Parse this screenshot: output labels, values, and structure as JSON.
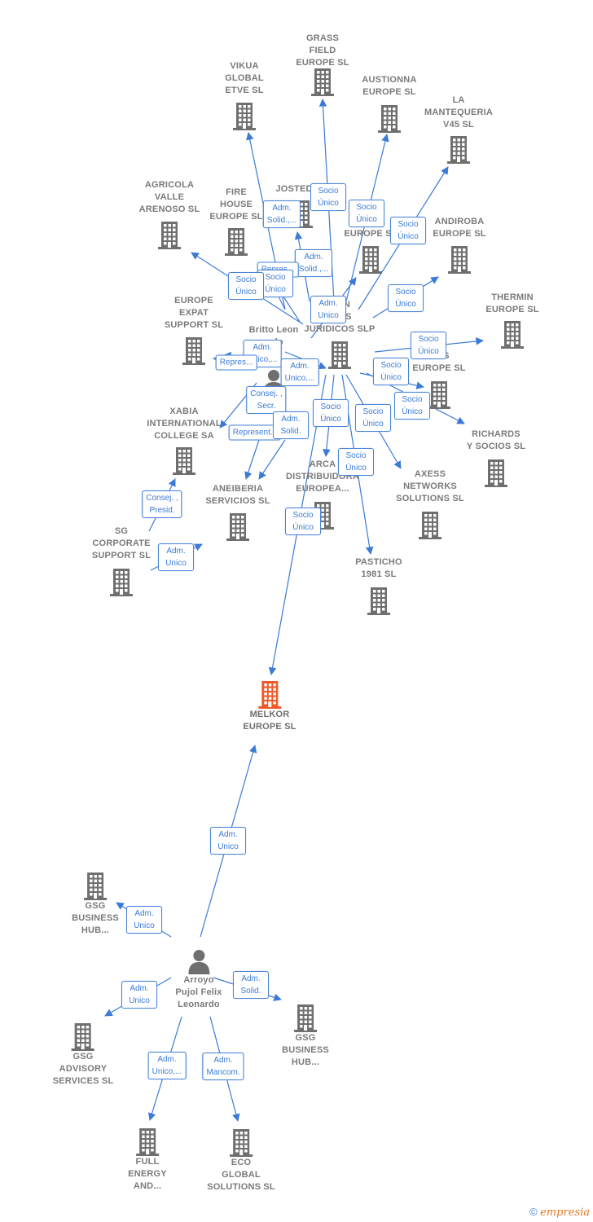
{
  "colors": {
    "edge": "#3b7ad6",
    "node": "#6f6f6f",
    "main_node": "#f05a28"
  },
  "nodes": [
    {
      "id": "melkor",
      "type": "company",
      "main": true,
      "label": "MELKOR\nEUROPE SL"
    },
    {
      "id": "grass",
      "type": "company",
      "label": "GRASS\nFIELD\nEUROPE SL"
    },
    {
      "id": "vikua",
      "type": "company",
      "label": "VIKUA\nGLOBAL\nETVE SL"
    },
    {
      "id": "austionna",
      "type": "company",
      "label": "AUSTIONNA\nEUROPE SL"
    },
    {
      "id": "mantequeria",
      "type": "company",
      "label": "LA\nMANTEQUERIA\nV45 SL"
    },
    {
      "id": "agricola",
      "type": "company",
      "label": "AGRICOLA\nVALLE\nARENOSO SL"
    },
    {
      "id": "fire",
      "type": "company",
      "label": "FIRE\nHOUSE\nEUROPE SL"
    },
    {
      "id": "jostedal",
      "type": "company",
      "label": "JOSTEDA..."
    },
    {
      "id": "aeurope",
      "type": "company",
      "label": "EUROPE SL"
    },
    {
      "id": "andiroba",
      "type": "company",
      "label": "ANDIROBA\nEUROPE SL"
    },
    {
      "id": "thermin",
      "type": "company",
      "label": "THERMIN\nEUROPE SL"
    },
    {
      "id": "expat",
      "type": "company",
      "label": "EUROPE\nEXPAT\nSUPPORT SL"
    },
    {
      "id": "britto",
      "type": "person",
      "label": "Britto Leon\n...do"
    },
    {
      "id": "juridicos",
      "type": "company",
      "label": "...AN\n...IOS\nJURIDICOS SLP"
    },
    {
      "id": "aseurope",
      "type": "company",
      "label": "...AS\nEUROPE SL"
    },
    {
      "id": "richards",
      "type": "company",
      "label": "RICHARDS\nY SOCIOS SL"
    },
    {
      "id": "xabia",
      "type": "company",
      "label": "XABIA\nINTERNATIONAL\nCOLLEGE SA"
    },
    {
      "id": "aneiberia",
      "type": "company",
      "label": "ANEIBERIA\nSERVICIOS SL"
    },
    {
      "id": "arca",
      "type": "company",
      "label": "ARCA\nDISTRIBUIDORA\nEUROPEA..."
    },
    {
      "id": "axess",
      "type": "company",
      "label": "AXESS\nNETWORKS\nSOLUTIONS SL"
    },
    {
      "id": "pasticho",
      "type": "company",
      "label": "PASTICHO\n1981 SL"
    },
    {
      "id": "sg",
      "type": "company",
      "label": "SG\nCORPORATE\nSUPPORT SL"
    },
    {
      "id": "gsg1",
      "type": "company",
      "label": "GSG\nBUSINESS\nHUB..."
    },
    {
      "id": "arroyo",
      "type": "person",
      "label": "Arroyo\nPujol Felix\nLeonardo"
    },
    {
      "id": "gsg2",
      "type": "company",
      "label": "GSG\nBUSINESS\nHUB..."
    },
    {
      "id": "advisory",
      "type": "company",
      "label": "GSG\nADVISORY\nSERVICES SL"
    },
    {
      "id": "full",
      "type": "company",
      "label": "FULL\nENERGY\nAND..."
    },
    {
      "id": "eco",
      "type": "company",
      "label": "ECO\nGLOBAL\nSOLUTIONS SL"
    }
  ],
  "edges": [
    {
      "from": "juridicos",
      "to": "grass",
      "label": "Socio\nÚnico"
    },
    {
      "from": "britto",
      "to": "vikua",
      "label": "Adm.\nSolid.,..."
    },
    {
      "from": "juridicos",
      "to": "austionna",
      "label": "Socio\nÚnico"
    },
    {
      "from": "juridicos",
      "to": "mantequeria",
      "label": "Socio\nÚnico"
    },
    {
      "from": "britto",
      "to": "jostedal",
      "label": "Adm.\nSolid.,..."
    },
    {
      "from": "britto",
      "to": "fire",
      "label": "Repres..."
    },
    {
      "from": "juridicos",
      "to": "fire",
      "label": "Socio\nÚnico"
    },
    {
      "from": "juridicos",
      "to": "agricola",
      "label": "Socio\nÚnico"
    },
    {
      "from": "britto",
      "to": "juridicos",
      "label": "Adm.\nUnico"
    },
    {
      "from": "juridicos",
      "to": "andiroba",
      "label": "Socio\nÚnico"
    },
    {
      "from": "juridicos",
      "to": "thermin",
      "label": "Socio\nÚnico"
    },
    {
      "from": "britto",
      "to": "expat",
      "label": "Adm.\nUnico,..."
    },
    {
      "from": "britto",
      "to": "expat",
      "label": "Repres..."
    },
    {
      "from": "britto",
      "to": "juridicos",
      "label": "Adm.\nUnico,..."
    },
    {
      "from": "juridicos",
      "to": "aseurope",
      "label": "Socio\nÚnico"
    },
    {
      "from": "juridicos",
      "to": "richards",
      "label": "Socio\nÚnico"
    },
    {
      "from": "britto",
      "to": "xabia",
      "label": "Consej. ,\nSecr."
    },
    {
      "from": "britto",
      "to": "aneiberia",
      "label": "Represent..."
    },
    {
      "from": "britto",
      "to": "aneiberia",
      "label": "Adm.\nSolid."
    },
    {
      "from": "juridicos",
      "to": "arca",
      "label": "Socio\nÚnico"
    },
    {
      "from": "juridicos",
      "to": "axess",
      "label": "Socio\nÚnico"
    },
    {
      "from": "juridicos",
      "to": "pasticho",
      "label": "Socio\nÚnico"
    },
    {
      "from": "juridicos",
      "to": "melkor",
      "label": "Socio\nÚnico"
    },
    {
      "from": "sg",
      "to": "xabia",
      "label": "Consej. ,\nPresid."
    },
    {
      "from": "sg",
      "to": "aneiberia",
      "label": "Adm.\nUnico"
    },
    {
      "from": "arroyo",
      "to": "melkor",
      "label": "Adm.\nUnico"
    },
    {
      "from": "arroyo",
      "to": "gsg1",
      "label": "Adm.\nUnico"
    },
    {
      "from": "arroyo",
      "to": "advisory",
      "label": "Adm.\nUnico"
    },
    {
      "from": "arroyo",
      "to": "gsg2",
      "label": "Adm.\nSolid."
    },
    {
      "from": "arroyo",
      "to": "full",
      "label": "Adm.\nUnico,..."
    },
    {
      "from": "arroyo",
      "to": "eco",
      "label": "Adm.\nMancom."
    }
  ],
  "footer": {
    "copyright": "©",
    "brand": "empresia"
  }
}
